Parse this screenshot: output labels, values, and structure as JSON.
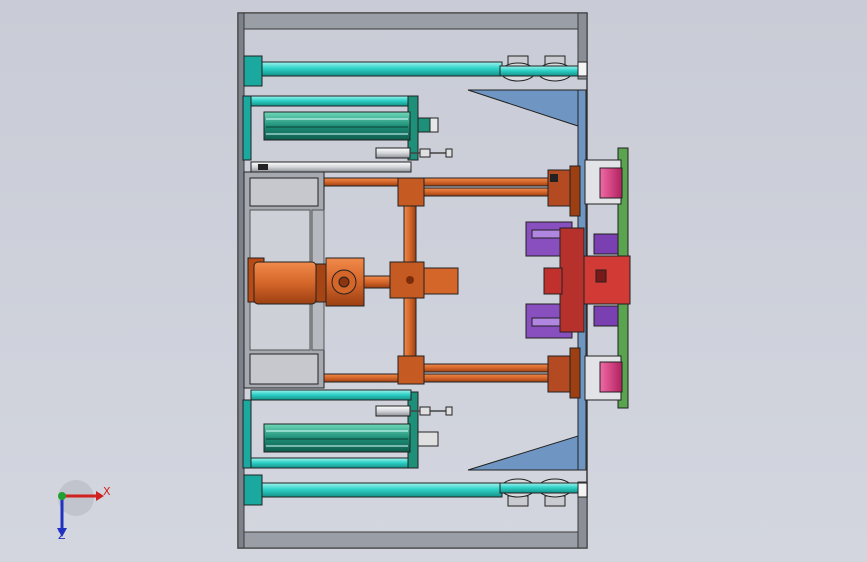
{
  "axis_triad": {
    "x_label": "X",
    "z_label": "Z"
  },
  "colors": {
    "background": "#cfd2db",
    "frame": "#8a8e96",
    "frame_edge": "#3a3a3a",
    "rod_cyan": "#2fd3c8",
    "cylinder_green": "#1e8f78",
    "orange_linkage": "#d5662a",
    "blue_wedge": "#6f95c2",
    "magenta_block": "#d0317b",
    "purple_clamp": "#8a4fbf",
    "red_block": "#c0302c",
    "green_plate": "#5aa34f"
  },
  "icons": [
    "axis-triad-icon"
  ]
}
